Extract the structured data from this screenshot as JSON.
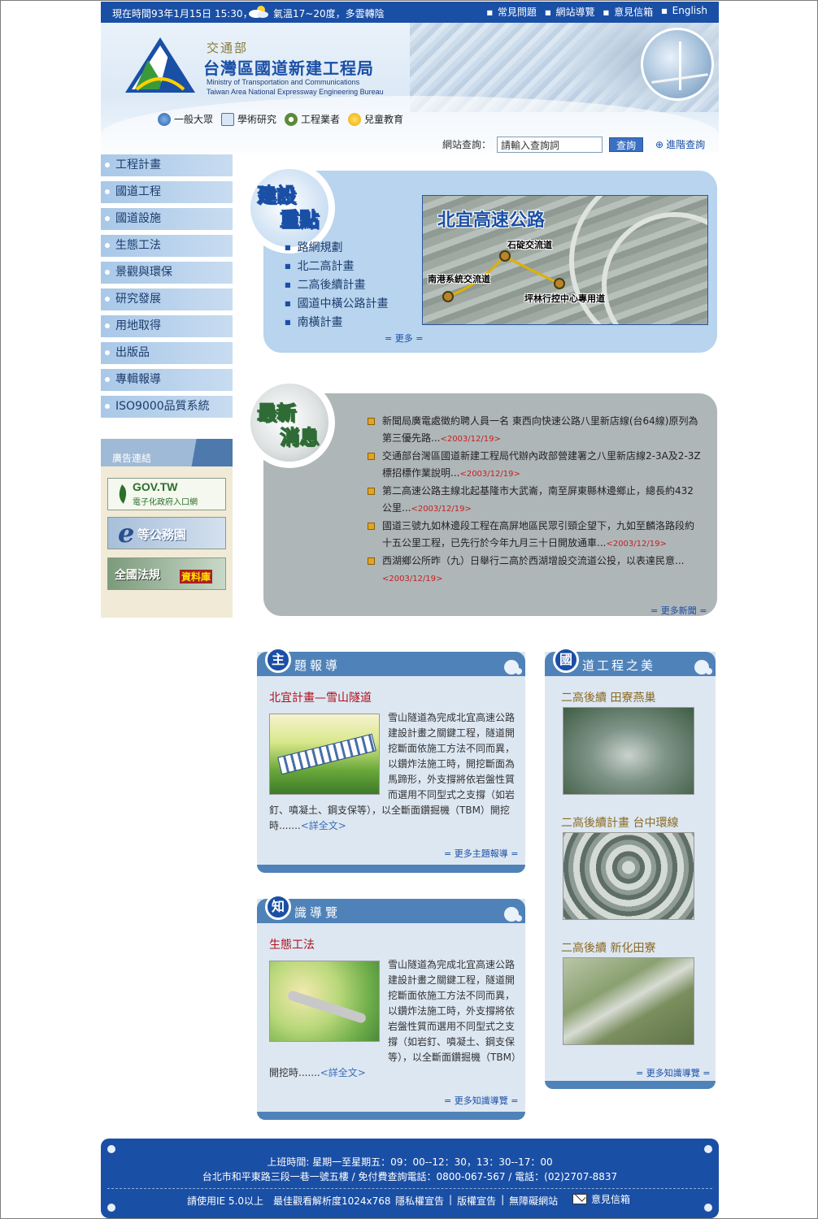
{
  "topbar": {
    "time": "現在時間93年1月15日 15:30，",
    "weather": "氣溫17~20度，多雲轉陰",
    "links": [
      "常見問題",
      "網站導覽",
      "意見信箱",
      "English"
    ]
  },
  "header": {
    "dept": "交通部",
    "org_name": "台灣區國道新建工程局",
    "org_en_line1": "Ministry of Transportation and Communications",
    "org_en_line2": "Taiwan Area National Expressway Engineering Bureau",
    "audience": [
      "一般大眾",
      "學術研究",
      "工程業者",
      "兒童教育"
    ]
  },
  "search": {
    "label": "網站查詢：",
    "placeholder": "請輸入查詢詞",
    "button": "查詢",
    "advanced": "進階查詢"
  },
  "nav": {
    "items": [
      "工程計畫",
      "國道工程",
      "國道設施",
      "生態工法",
      "景觀與環保",
      "研究發展",
      "用地取得",
      "出版品",
      "專輯報導",
      "ISO9000品質系統"
    ]
  },
  "ads": {
    "title": "廣告連結",
    "gov_line1": "GOV.TW",
    "gov_line2": "電子化政府入口網",
    "egov_letter": "e",
    "egov": "等公務園",
    "law_1": "全國法規",
    "law_2": "資料庫"
  },
  "feature": {
    "badge": [
      "建設",
      "重點"
    ],
    "items": [
      "路網規劃",
      "北二高計畫",
      "二高後續計畫",
      "國道中橫公路計畫",
      "南橫計畫"
    ],
    "more": "= 更多 =",
    "map_title": "北宜高速公路",
    "map_labels": [
      "石碇交流道",
      "南港系統交流道",
      "坪林行控中心專用道"
    ]
  },
  "news": {
    "badge": [
      "最新",
      "消息"
    ],
    "items": [
      {
        "text": "新聞局廣電處徵約聘人員一名 東西向快速公路八里新店線(台64線)原列為第三優先路...",
        "date": "<2003/12/19>"
      },
      {
        "text": "交通部台灣區國道新建工程局代辦內政部營建署之八里新店線2-3A及2-3Z標招標作業說明...",
        "date": "<2003/12/19>"
      },
      {
        "text": "第二高速公路主線北起基隆市大武崙，南至屏東縣林邊鄉止，總長約432公里...",
        "date": "<2003/12/19>"
      },
      {
        "text": "國道三號九如林邊段工程在高屏地區民眾引頸企望下，九如至麟洛路段約十五公里工程，已先行於今年九月三十日開放通車...",
        "date": "<2003/12/19>"
      },
      {
        "text": "西湖鄉公所昨（九）日舉行二高於西湖增設交流道公投，以表達民意...",
        "date": "<2003/12/19>"
      }
    ],
    "more": "= 更多新聞 ="
  },
  "topic": {
    "icon": "主",
    "title": "題報導",
    "article_title": "北宜計畫—雪山隧道",
    "body": "雪山隧道為完成北宜高速公路建設計畫之關鍵工程，隧道開挖斷面依施工方法不同而異，以鑽炸法施工時，開挖斷面為馬蹄形，外支撐將依岩盤性質而選用不同型式之支撐（如岩釘、噴凝土、鋼支保等），以全斷面鑽掘機（TBM）開挖時.......",
    "link": "<詳全文>",
    "more": "= 更多主題報導 ="
  },
  "knowledge": {
    "icon": "知",
    "title": "識導覽",
    "article_title": "生態工法",
    "body": "雪山隧道為完成北宜高速公路建設計畫之關鍵工程，隧道開挖斷面依施工方法不同而異，以鑽炸法施工時，外支撐將依岩盤性質而選用不同型式之支撐（如岩釘、噴凝土、鋼支保等），以全斷面鑽掘機（TBM）開挖時.......",
    "link": "<詳全文>",
    "more": "= 更多知識導覽 ="
  },
  "gallery": {
    "icon": "國",
    "title": "道工程之美",
    "items": [
      "二高後續 田寮燕巢",
      "二高後續計畫 台中環線",
      "二高後續 新化田寮"
    ]
  },
  "footer": {
    "hours": "上班時間: 星期一至星期五：09：00--12：30，13：30--17：00",
    "address": "台北市和平東路三段一巷一號五樓 / 免付費查詢電話：0800-067-567 / 電話：(02)2707-8837",
    "browser": "請使用IE 5.0以上　最佳觀看解析度1024x768",
    "links": [
      "隱私權宣告",
      "版權宣告",
      "無障礙網站"
    ],
    "mailbox": "意見信箱"
  },
  "colors": {
    "brand_blue": "#1a4fa6",
    "feature_bg": "#b8d4ee",
    "news_bg": "#afb6b8",
    "date_red": "#c81e1e"
  }
}
